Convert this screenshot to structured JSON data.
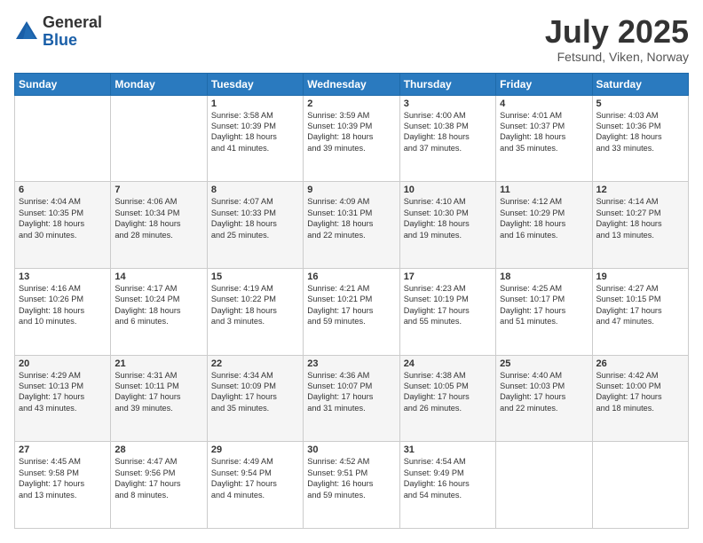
{
  "logo": {
    "general": "General",
    "blue": "Blue"
  },
  "title": "July 2025",
  "location": "Fetsund, Viken, Norway",
  "days_of_week": [
    "Sunday",
    "Monday",
    "Tuesday",
    "Wednesday",
    "Thursday",
    "Friday",
    "Saturday"
  ],
  "weeks": [
    [
      {
        "day": "",
        "content": ""
      },
      {
        "day": "",
        "content": ""
      },
      {
        "day": "1",
        "content": "Sunrise: 3:58 AM\nSunset: 10:39 PM\nDaylight: 18 hours\nand 41 minutes."
      },
      {
        "day": "2",
        "content": "Sunrise: 3:59 AM\nSunset: 10:39 PM\nDaylight: 18 hours\nand 39 minutes."
      },
      {
        "day": "3",
        "content": "Sunrise: 4:00 AM\nSunset: 10:38 PM\nDaylight: 18 hours\nand 37 minutes."
      },
      {
        "day": "4",
        "content": "Sunrise: 4:01 AM\nSunset: 10:37 PM\nDaylight: 18 hours\nand 35 minutes."
      },
      {
        "day": "5",
        "content": "Sunrise: 4:03 AM\nSunset: 10:36 PM\nDaylight: 18 hours\nand 33 minutes."
      }
    ],
    [
      {
        "day": "6",
        "content": "Sunrise: 4:04 AM\nSunset: 10:35 PM\nDaylight: 18 hours\nand 30 minutes."
      },
      {
        "day": "7",
        "content": "Sunrise: 4:06 AM\nSunset: 10:34 PM\nDaylight: 18 hours\nand 28 minutes."
      },
      {
        "day": "8",
        "content": "Sunrise: 4:07 AM\nSunset: 10:33 PM\nDaylight: 18 hours\nand 25 minutes."
      },
      {
        "day": "9",
        "content": "Sunrise: 4:09 AM\nSunset: 10:31 PM\nDaylight: 18 hours\nand 22 minutes."
      },
      {
        "day": "10",
        "content": "Sunrise: 4:10 AM\nSunset: 10:30 PM\nDaylight: 18 hours\nand 19 minutes."
      },
      {
        "day": "11",
        "content": "Sunrise: 4:12 AM\nSunset: 10:29 PM\nDaylight: 18 hours\nand 16 minutes."
      },
      {
        "day": "12",
        "content": "Sunrise: 4:14 AM\nSunset: 10:27 PM\nDaylight: 18 hours\nand 13 minutes."
      }
    ],
    [
      {
        "day": "13",
        "content": "Sunrise: 4:16 AM\nSunset: 10:26 PM\nDaylight: 18 hours\nand 10 minutes."
      },
      {
        "day": "14",
        "content": "Sunrise: 4:17 AM\nSunset: 10:24 PM\nDaylight: 18 hours\nand 6 minutes."
      },
      {
        "day": "15",
        "content": "Sunrise: 4:19 AM\nSunset: 10:22 PM\nDaylight: 18 hours\nand 3 minutes."
      },
      {
        "day": "16",
        "content": "Sunrise: 4:21 AM\nSunset: 10:21 PM\nDaylight: 17 hours\nand 59 minutes."
      },
      {
        "day": "17",
        "content": "Sunrise: 4:23 AM\nSunset: 10:19 PM\nDaylight: 17 hours\nand 55 minutes."
      },
      {
        "day": "18",
        "content": "Sunrise: 4:25 AM\nSunset: 10:17 PM\nDaylight: 17 hours\nand 51 minutes."
      },
      {
        "day": "19",
        "content": "Sunrise: 4:27 AM\nSunset: 10:15 PM\nDaylight: 17 hours\nand 47 minutes."
      }
    ],
    [
      {
        "day": "20",
        "content": "Sunrise: 4:29 AM\nSunset: 10:13 PM\nDaylight: 17 hours\nand 43 minutes."
      },
      {
        "day": "21",
        "content": "Sunrise: 4:31 AM\nSunset: 10:11 PM\nDaylight: 17 hours\nand 39 minutes."
      },
      {
        "day": "22",
        "content": "Sunrise: 4:34 AM\nSunset: 10:09 PM\nDaylight: 17 hours\nand 35 minutes."
      },
      {
        "day": "23",
        "content": "Sunrise: 4:36 AM\nSunset: 10:07 PM\nDaylight: 17 hours\nand 31 minutes."
      },
      {
        "day": "24",
        "content": "Sunrise: 4:38 AM\nSunset: 10:05 PM\nDaylight: 17 hours\nand 26 minutes."
      },
      {
        "day": "25",
        "content": "Sunrise: 4:40 AM\nSunset: 10:03 PM\nDaylight: 17 hours\nand 22 minutes."
      },
      {
        "day": "26",
        "content": "Sunrise: 4:42 AM\nSunset: 10:00 PM\nDaylight: 17 hours\nand 18 minutes."
      }
    ],
    [
      {
        "day": "27",
        "content": "Sunrise: 4:45 AM\nSunset: 9:58 PM\nDaylight: 17 hours\nand 13 minutes."
      },
      {
        "day": "28",
        "content": "Sunrise: 4:47 AM\nSunset: 9:56 PM\nDaylight: 17 hours\nand 8 minutes."
      },
      {
        "day": "29",
        "content": "Sunrise: 4:49 AM\nSunset: 9:54 PM\nDaylight: 17 hours\nand 4 minutes."
      },
      {
        "day": "30",
        "content": "Sunrise: 4:52 AM\nSunset: 9:51 PM\nDaylight: 16 hours\nand 59 minutes."
      },
      {
        "day": "31",
        "content": "Sunrise: 4:54 AM\nSunset: 9:49 PM\nDaylight: 16 hours\nand 54 minutes."
      },
      {
        "day": "",
        "content": ""
      },
      {
        "day": "",
        "content": ""
      }
    ]
  ]
}
